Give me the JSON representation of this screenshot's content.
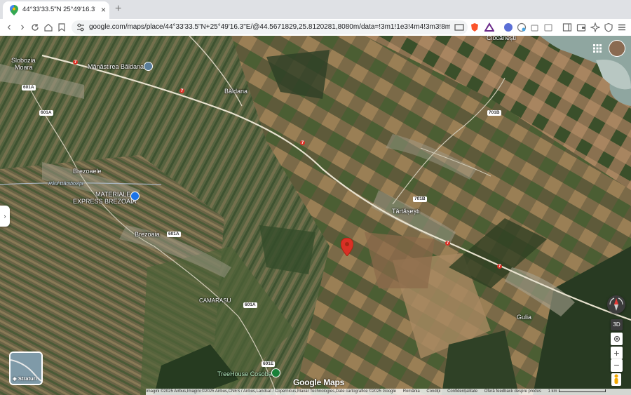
{
  "browser": {
    "tab_title": "44°33'33.5\"N 25°49'16.3\"E -",
    "tab_close": "×",
    "new_tab": "+",
    "url": "google.com/maps/place/44°33'33.5\"N+25°49'16.3\"E/@44.5671829,25.8120281,8080m/data=!3m1!1e3!4m4!3m3!8m2!3d...",
    "back_icon": "‹",
    "forward_icon": "›"
  },
  "map": {
    "places": {
      "slobozia": "Slobozia",
      "moara": "Moara",
      "manastirea": "Mănăstirea Băldana",
      "baldana": "Băldana",
      "ciocanesti": "Ciocănești",
      "brezoaele": "Brezoaele",
      "raul": "Râul Dâmbovița",
      "materiale_1": "MATERIALE",
      "materiale_2": "EXPRESS BREZOAIA",
      "brezoaia": "Brezoaia",
      "tartasesti": "Tărtășești",
      "camarasu": "CAMARASU",
      "gulia": "Gulia",
      "treehouse": "TreeHouse Cosoba"
    },
    "road_shields": {
      "r7a": "7",
      "r7b": "7",
      "r7c": "7",
      "r7d": "7",
      "r7e": "7",
      "r601a_1": "601A",
      "r601a_2": "601A",
      "r601a_3": "601A",
      "r601a_4": "601A",
      "r701b_1": "701B",
      "r701b_2": "701B",
      "r601e": "601E"
    },
    "layers_label": "Straturi",
    "side_handle": "›",
    "zoom_in": "+",
    "zoom_out": "−",
    "view_3d": "3D",
    "google_logo": "Google Maps",
    "attribution": {
      "imagery": "Imagini ©2025 Airbus,Imagini ©2025 Airbus,CNES / Airbus,Landsat / Copernicus,Maxar Technologies,Date cartografice ©2025 Google",
      "country": "România",
      "terms": "Condiții",
      "privacy": "Confidențialitate",
      "feedback": "Oferă feedback despre produs",
      "scale": "1 km"
    }
  },
  "colors": {
    "pin": "#d93025",
    "field_green": "#3f5a2c",
    "field_brown": "#7a6a4a"
  }
}
